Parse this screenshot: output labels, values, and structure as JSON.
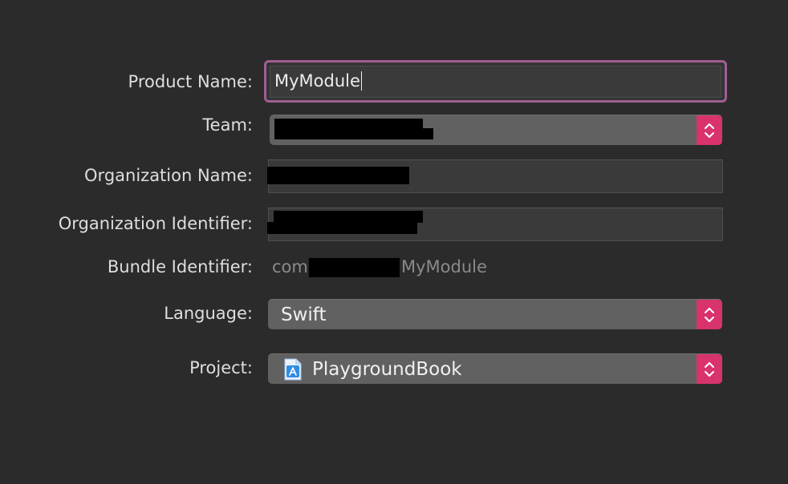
{
  "form": {
    "product_name": {
      "label": "Product Name:",
      "value": "MyModule"
    },
    "team": {
      "label": "Team:",
      "value": ""
    },
    "organization_name": {
      "label": "Organization Name:",
      "value": ""
    },
    "organization_identifier": {
      "label": "Organization Identifier:",
      "value": ""
    },
    "bundle_identifier": {
      "label": "Bundle Identifier:",
      "prefix": "com",
      "suffix": "MyModule"
    },
    "language": {
      "label": "Language:",
      "value": "Swift"
    },
    "project": {
      "label": "Project:",
      "value": "PlaygroundBook",
      "icon": "swift-playground-file-icon"
    }
  },
  "colors": {
    "background": "#2b2b2b",
    "focus_ring": "#a25d93",
    "accent": "#d8336d",
    "popup_fill": "#616161",
    "field_fill": "#3a3a3a"
  }
}
